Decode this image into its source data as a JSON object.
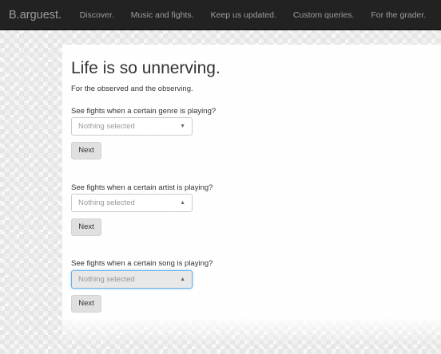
{
  "navbar": {
    "brand": "B.arguest.",
    "links": [
      "Discover.",
      "Music and fights.",
      "Keep us updated.",
      "Custom queries.",
      "For the grader."
    ]
  },
  "main": {
    "title": "Life is so unnerving.",
    "subtitle": "For the observed and the observing.",
    "queries": [
      {
        "label": "See fights when a certain genre is playing?",
        "placeholder": "Nothing selected",
        "caret": "▼",
        "button": "Next"
      },
      {
        "label": "See fights when a certain artist is playing?",
        "placeholder": "Nothing selected",
        "caret": "▲",
        "button": "Next"
      },
      {
        "label": "See fights when a certain song is playing?",
        "placeholder": "Nothing selected",
        "caret": "▲",
        "button": "Next"
      }
    ]
  }
}
